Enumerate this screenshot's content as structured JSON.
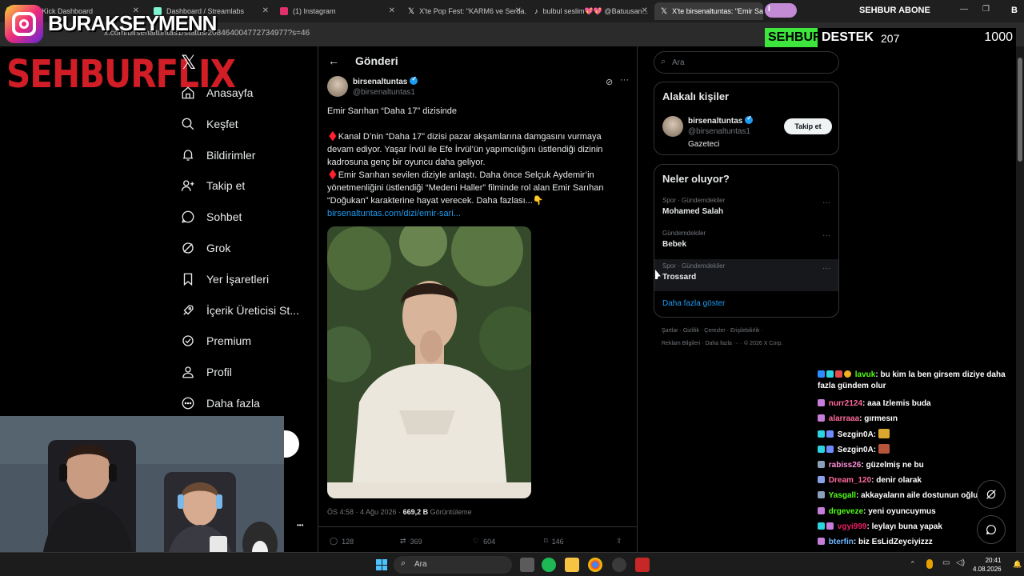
{
  "browser": {
    "tabs": [
      {
        "label": "ream - Kick Dashboard",
        "color": "#53fc18"
      },
      {
        "label": "Dashboard / Streamlabs",
        "color": "#80f5d2"
      },
      {
        "label": "(1) Instagram",
        "color": "#e1306c"
      },
      {
        "label": "X'te Pop Fest: \"KARM6 ve Serda...",
        "color": "#ffffff"
      },
      {
        "label": "bulbul seslim💖💖 @Batuusan...",
        "color": "#ffffff"
      },
      {
        "label": "X'te birsenaltuntas: \"Emir Sarıha...",
        "color": "#ffffff"
      }
    ],
    "url": "x.com/birsenaltuntas1/status/208464004772734977?s=46"
  },
  "overlay": {
    "instagram_handle": "BURAKSEYMENN",
    "brand": "SEHBURFLIX",
    "abone_label": "SEHBUR ABONE",
    "abone_end": "B",
    "abone_start": "I",
    "destek_part1": "SEHBUR",
    "destek_part2": "DESTEK",
    "destek_current": "207",
    "destek_goal": "1000"
  },
  "nav": {
    "x_logo": "𝕏",
    "items": [
      {
        "label": "Anasayfa",
        "icon": "home-icon"
      },
      {
        "label": "Keşfet",
        "icon": "search-icon"
      },
      {
        "label": "Bildirimler",
        "icon": "bell-icon"
      },
      {
        "label": "Takip et",
        "icon": "add-user-icon"
      },
      {
        "label": "Sohbet",
        "icon": "chat-icon"
      },
      {
        "label": "Grok",
        "icon": "grok-icon"
      },
      {
        "label": "Yer İşaretleri",
        "icon": "bookmark-icon"
      },
      {
        "label": "İçerik Üreticisi St...",
        "icon": "rocket-icon"
      },
      {
        "label": "Premium",
        "icon": "verified-icon"
      },
      {
        "label": "Profil",
        "icon": "profile-icon"
      },
      {
        "label": "Daha fazla",
        "icon": "more-circle-icon"
      }
    ],
    "more_dots": "•••"
  },
  "post": {
    "header_title": "Gönderi",
    "back": "←",
    "author_name": "birsenaltuntas",
    "author_handle": "@birsenaltuntas1",
    "line1": "Emir Sarıhan “Daha 17” dizisinde",
    "para1": "Kanal D’nin “Daha 17” dizisi pazar akşamlarına damgasını vurmaya devam ediyor. Yaşar İrvül ile Efe İrvül’ün yapımcılığını üstlendiği dizinin kadrosuna genç bir oyuncu daha geliyor.",
    "para2": "Emir Sarıhan sevilen diziyle anlaştı. Daha önce Selçuk Aydemir’in yönetmenliğini üstlendiği “Medeni Haller” filminde rol alan Emir Sarıhan “Doğukan” karakterine hayat verecek. Daha fazlası...👇",
    "diamond": "♦️",
    "link": "birsenaltuntas.com/dizi/emir-sari...",
    "time": "ÖS 4:58 · 4 Ağu 2026 · ",
    "views_count": "669,2 B",
    "views_label": " Görüntüleme",
    "replies": "128",
    "reposts": "369",
    "likes": "604",
    "bookmarks": "146"
  },
  "right": {
    "search_placeholder": "Ara",
    "relevant_title": "Alakalı kişiler",
    "person_name": "birsenaltuntas",
    "person_handle": "@birsenaltuntas1",
    "person_bio": "Gazeteci",
    "follow_label": "Takip et",
    "trends_title": "Neler oluyor?",
    "trends": [
      {
        "category": "Spor · Gündemdekiler",
        "name": "Mohamed Salah"
      },
      {
        "category": "Gündemdekiler",
        "name": "Bebek"
      },
      {
        "category": "Spor · Gündemdekiler",
        "name": "Trossard"
      }
    ],
    "trend_more": "···",
    "show_more": "Daha fazla göster",
    "footer_line1": "Şartlar  ·  Gizlilik  ·  Çerezler  ·  Erişilebilirlik  ·",
    "footer_line2": "Reklam Bilgileri  ·  Daha fazla ···  ·  © 2026 X Corp."
  },
  "chat": [
    {
      "user": "lavuk",
      "color": "#53fc18",
      "text": ": bu kim la ben girsem diziye daha fazla gündem olur"
    },
    {
      "user": "nurr2124",
      "color": "#ff6b9d",
      "text": ": aaa Izlemis buda"
    },
    {
      "user": "alarraaa",
      "color": "#ff6b9d",
      "text": ": gırmesın"
    },
    {
      "user": "Sezgin0A",
      "color": "#ffffff",
      "text": ": "
    },
    {
      "user": "Sezgin0A",
      "color": "#ffffff",
      "text": ": "
    },
    {
      "user": "rabiss26",
      "color": "#ff8fd8",
      "text": ": güzelmiş ne bu"
    },
    {
      "user": "Dream_120",
      "color": "#ff6b9d",
      "text": ": denir olarak"
    },
    {
      "user": "Yasgall",
      "color": "#53fc18",
      "text": ": akkayaların aile dostunun oğlu"
    },
    {
      "user": "drgeveze",
      "color": "#53fc18",
      "text": ": yeni oyuncuymus"
    },
    {
      "user": "vgyi999",
      "color": "#e91e63",
      "text": ": leylayı buna yapak"
    },
    {
      "user": "bterfin",
      "color": "#6fb6ff",
      "text": ": biz EsLidZeyciyizzz"
    }
  ],
  "taskbar": {
    "search": "Ara",
    "time": "20:41",
    "date": "4.08.2026"
  }
}
